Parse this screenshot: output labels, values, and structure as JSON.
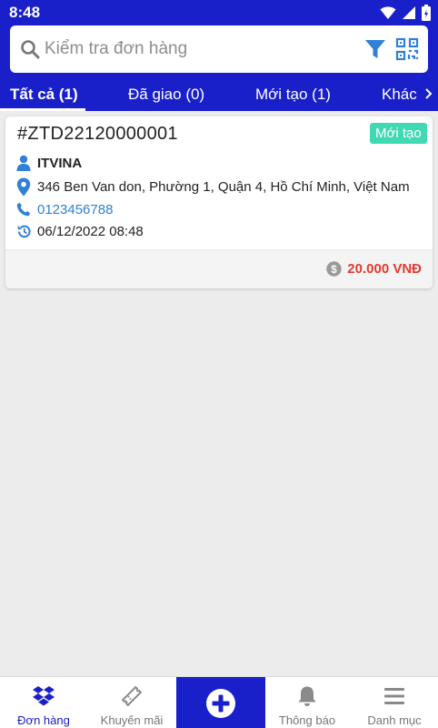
{
  "status_bar": {
    "time": "8:48"
  },
  "search": {
    "placeholder": "Kiểm tra đơn hàng"
  },
  "tabs": [
    {
      "label": "Tất cả (1)",
      "active": true
    },
    {
      "label": "Đã giao (0)",
      "active": false
    },
    {
      "label": "Mới tạo (1)",
      "active": false
    },
    {
      "label": "Khác",
      "active": false
    }
  ],
  "order": {
    "code": "#ZTD22120000001",
    "status": "Mới tạo",
    "customer": "ITVINA",
    "address": "346 Ben Van don, Phường 1, Quận 4, Hồ Chí Minh, Việt Nam",
    "phone": "0123456788",
    "datetime": "06/12/2022 08:48",
    "price": "20.000 VNĐ"
  },
  "bottom_nav": [
    {
      "label": "Đơn hàng",
      "icon": "dropbox-icon",
      "active": true
    },
    {
      "label": "Khuyến mãi",
      "icon": "ticket-icon",
      "active": false
    },
    {
      "label": "",
      "icon": "plus-circle-icon",
      "active": false
    },
    {
      "label": "Thông báo",
      "icon": "bell-icon",
      "active": false
    },
    {
      "label": "Danh mục",
      "icon": "menu-icon",
      "active": false
    }
  ],
  "colors": {
    "primary": "#1a20c9",
    "badge": "#3fd9b4",
    "accent_icon": "#2f80d6",
    "price": "#e23b2e"
  }
}
